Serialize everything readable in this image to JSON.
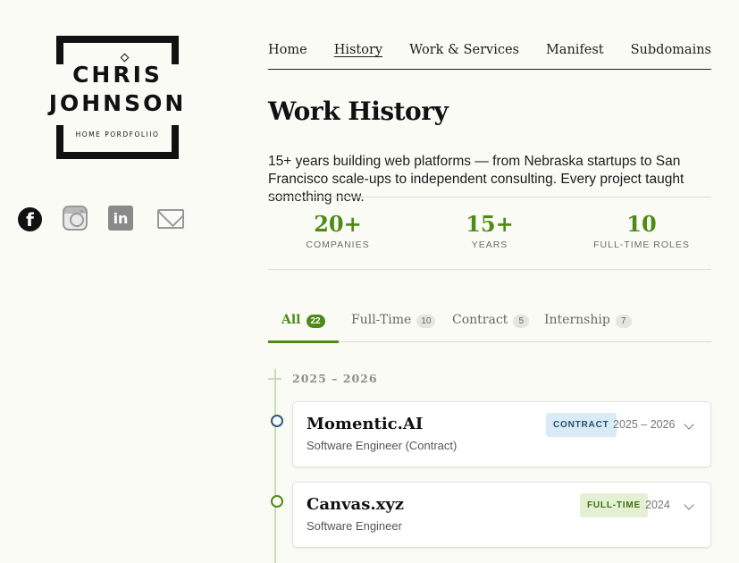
{
  "brand": {
    "first_name": "CHRIS",
    "last_name": "JOHNSON",
    "tagline": "HOME PORDFOLIIO"
  },
  "social": [
    {
      "icon": "facebook-icon",
      "glyph": "f"
    },
    {
      "icon": "instagram-icon",
      "glyph": ""
    },
    {
      "icon": "linkedin-icon",
      "glyph": "in"
    },
    {
      "icon": "mail-icon",
      "glyph": ""
    }
  ],
  "nav": {
    "items": [
      "Home",
      "History",
      "Work & Services",
      "Manifest",
      "Subdomains"
    ],
    "active": "History"
  },
  "page": {
    "title": "Work History",
    "intro": "15+ years building web platforms — from Nebraska startups to San Francisco scale-ups to independent consulting. Every project taught something new."
  },
  "stats": [
    {
      "value": "20+",
      "label": "COMPANIES"
    },
    {
      "value": "15+",
      "label": "YEARS"
    },
    {
      "value": "10",
      "label": "FULL-TIME ROLES"
    }
  ],
  "tabs": [
    {
      "label": "All",
      "count": "22",
      "active": true
    },
    {
      "label": "Full-Time",
      "count": "10",
      "active": false
    },
    {
      "label": "Contract",
      "count": "5",
      "active": false
    },
    {
      "label": "Internship",
      "count": "7",
      "active": false
    }
  ],
  "timeline": {
    "year_group": "2025 – 2026",
    "entries": [
      {
        "company": "Momentic.AI",
        "role": "Software Engineer (Contract)",
        "type": "CONTRACT",
        "years": "2025 – 2026"
      },
      {
        "company": "Canvas.xyz",
        "role": "Software Engineer",
        "type": "FULL-TIME",
        "years": "2024"
      }
    ]
  },
  "colors": {
    "accent": "#4e8a16",
    "contract_badge_bg": "#d9ebf6",
    "fulltime_badge_bg": "#e4f0d3",
    "background": "#fbfbf6"
  }
}
